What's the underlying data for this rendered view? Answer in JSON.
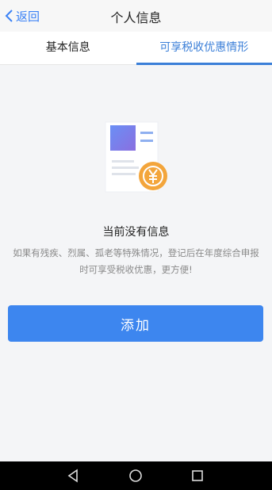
{
  "header": {
    "back_label": "返回",
    "title": "个人信息"
  },
  "tabs": [
    {
      "label": "基本信息",
      "active": false
    },
    {
      "label": "可享税收优惠情形",
      "active": true
    }
  ],
  "empty_state": {
    "title": "当前没有信息",
    "description": "如果有残疾、烈属、孤老等特殊情况，登记后在年度综合申报时可享受税收优惠，更方便!",
    "illustration_icon": "yuan-coin-document-icon"
  },
  "actions": {
    "add_label": "添加"
  },
  "colors": {
    "accent": "#3b7fd8",
    "button": "#3d86ef",
    "coin": "#f3a53b"
  },
  "system_nav": {
    "icons": [
      "back-triangle-icon",
      "home-circle-icon",
      "recents-square-icon"
    ]
  }
}
